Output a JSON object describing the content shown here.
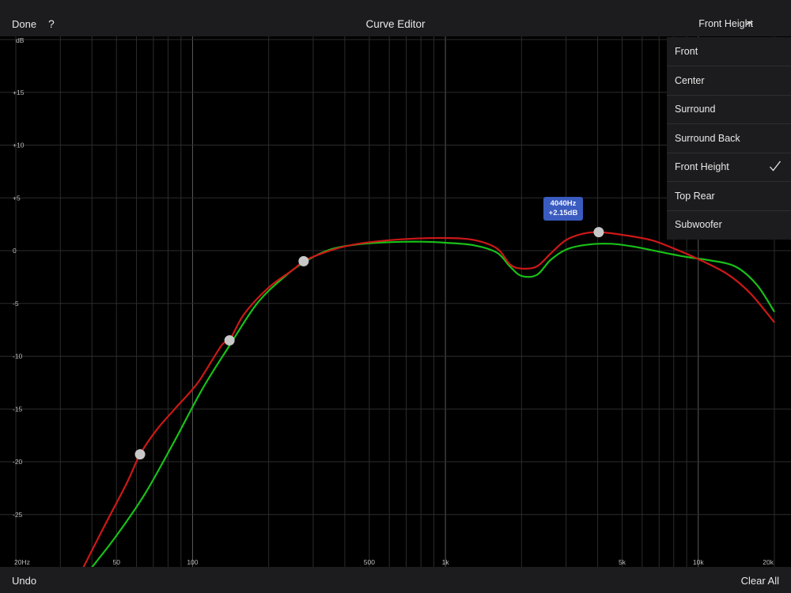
{
  "toolbar": {
    "done_label": "Done",
    "help_label": "?",
    "title": "Curve Editor",
    "channel_selected": "Front Height",
    "undo_label": "Undo",
    "clear_all_label": "Clear All"
  },
  "menu": {
    "items": [
      {
        "label": "Front",
        "checked": false
      },
      {
        "label": "Center",
        "checked": false
      },
      {
        "label": "Surround",
        "checked": false
      },
      {
        "label": "Surround Back",
        "checked": false
      },
      {
        "label": "Front Height",
        "checked": true
      },
      {
        "label": "Top Rear",
        "checked": false
      },
      {
        "label": "Subwoofer",
        "checked": false
      }
    ]
  },
  "tooltip": {
    "freq": "4040Hz",
    "gain": "+2.15dB"
  },
  "colors": {
    "red_curve": "#cc1818",
    "green_curve": "#18c018",
    "handle": "#c8c8c8",
    "tooltip_bg": "#3a5bbf"
  },
  "chart_data": {
    "type": "line",
    "xscale": "log",
    "xlim": [
      20,
      20000
    ],
    "ylim": [
      -30,
      20
    ],
    "ylabel": "dB",
    "y_ticks": [
      {
        "v": 15,
        "label": "+15"
      },
      {
        "v": 10,
        "label": "+10"
      },
      {
        "v": 5,
        "label": "+5"
      },
      {
        "v": 0,
        "label": "0"
      },
      {
        "v": -5,
        "label": "-5"
      },
      {
        "v": -10,
        "label": "-10"
      },
      {
        "v": -15,
        "label": "-15"
      },
      {
        "v": -20,
        "label": "-20"
      },
      {
        "v": -25,
        "label": "-25"
      }
    ],
    "x_ticks": [
      {
        "v": 20,
        "label": "20Hz"
      },
      {
        "v": 50,
        "label": "50"
      },
      {
        "v": 100,
        "label": "100"
      },
      {
        "v": 500,
        "label": "500"
      },
      {
        "v": 1000,
        "label": "1k"
      },
      {
        "v": 5000,
        "label": "5k"
      },
      {
        "v": 10000,
        "label": "10k"
      },
      {
        "v": 20000,
        "label": "20k"
      }
    ],
    "series": [
      {
        "color": "#cc1818",
        "points": [
          [
            37,
            -30
          ],
          [
            45,
            -26
          ],
          [
            55,
            -22
          ],
          [
            62,
            -19.3
          ],
          [
            72,
            -17
          ],
          [
            85,
            -15
          ],
          [
            105,
            -12.5
          ],
          [
            130,
            -9
          ],
          [
            140,
            -8.5
          ],
          [
            160,
            -6
          ],
          [
            200,
            -3.5
          ],
          [
            250,
            -1.8
          ],
          [
            275,
            -1
          ],
          [
            330,
            -0.2
          ],
          [
            400,
            0.4
          ],
          [
            500,
            0.8
          ],
          [
            700,
            1.1
          ],
          [
            1000,
            1.2
          ],
          [
            1300,
            1.0
          ],
          [
            1600,
            0.2
          ],
          [
            1800,
            -1.3
          ],
          [
            2000,
            -1.7
          ],
          [
            2300,
            -1.5
          ],
          [
            2600,
            -0.3
          ],
          [
            3000,
            1.0
          ],
          [
            3500,
            1.6
          ],
          [
            4040,
            1.75
          ],
          [
            5000,
            1.5
          ],
          [
            6500,
            1.0
          ],
          [
            8000,
            0.2
          ],
          [
            10000,
            -0.8
          ],
          [
            13000,
            -2.2
          ],
          [
            16000,
            -4
          ],
          [
            20000,
            -6.8
          ]
        ]
      },
      {
        "color": "#18c018",
        "points": [
          [
            40,
            -30
          ],
          [
            50,
            -27
          ],
          [
            65,
            -23
          ],
          [
            85,
            -18
          ],
          [
            110,
            -13
          ],
          [
            140,
            -9
          ],
          [
            180,
            -5
          ],
          [
            230,
            -2.5
          ],
          [
            280,
            -1
          ],
          [
            350,
            0.1
          ],
          [
            450,
            0.6
          ],
          [
            600,
            0.8
          ],
          [
            800,
            0.85
          ],
          [
            1000,
            0.75
          ],
          [
            1300,
            0.5
          ],
          [
            1600,
            -0.2
          ],
          [
            1800,
            -1.5
          ],
          [
            2000,
            -2.4
          ],
          [
            2300,
            -2.3
          ],
          [
            2600,
            -0.9
          ],
          [
            3000,
            0.1
          ],
          [
            3600,
            0.55
          ],
          [
            4500,
            0.65
          ],
          [
            5500,
            0.4
          ],
          [
            7000,
            -0.1
          ],
          [
            9000,
            -0.6
          ],
          [
            11000,
            -0.9
          ],
          [
            14000,
            -1.5
          ],
          [
            17000,
            -3.2
          ],
          [
            20000,
            -5.8
          ]
        ]
      }
    ],
    "handles": [
      [
        62,
        -19.3
      ],
      [
        140,
        -8.5
      ],
      [
        275,
        -1.0
      ],
      [
        4040,
        1.75
      ]
    ]
  }
}
